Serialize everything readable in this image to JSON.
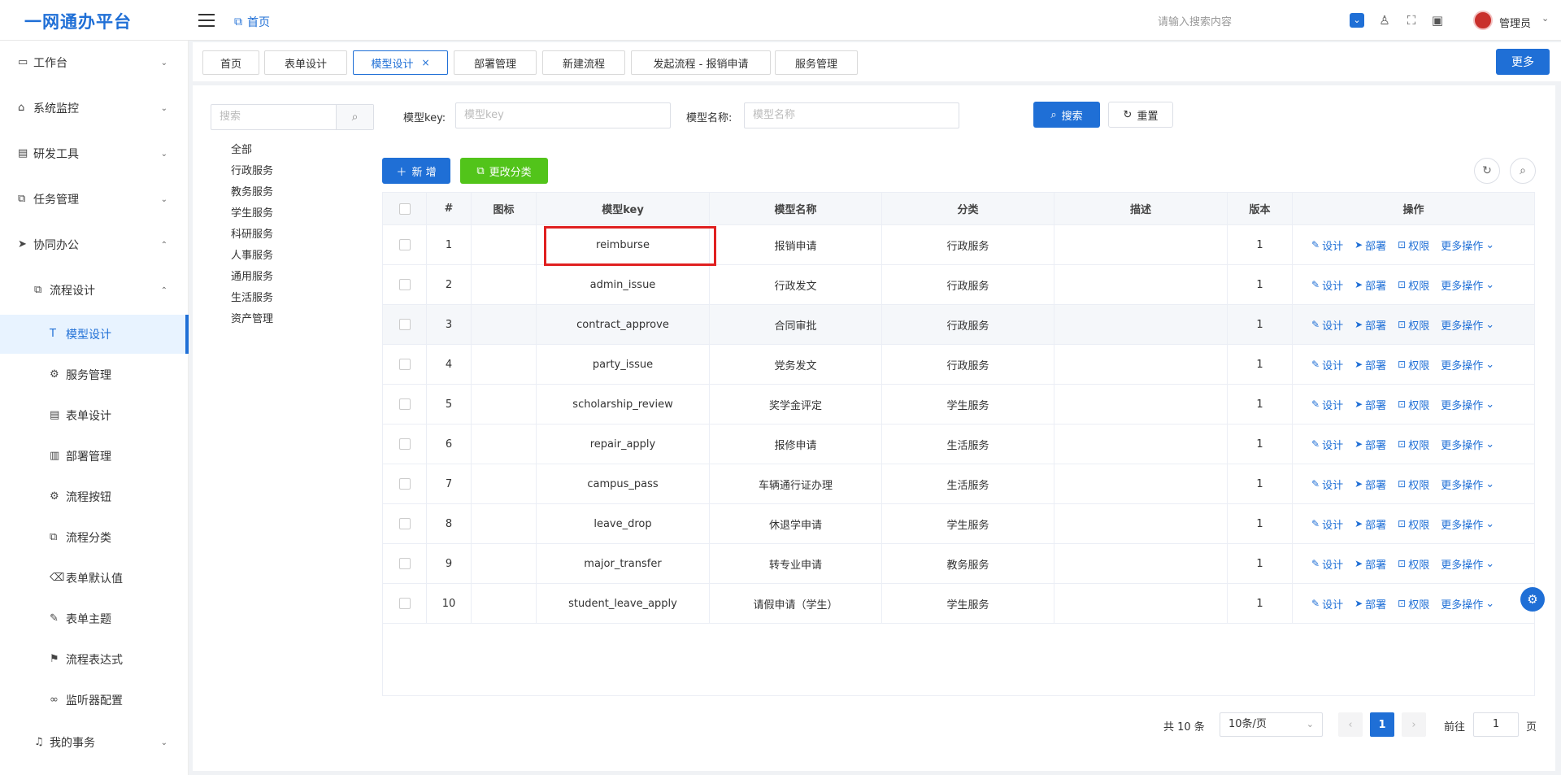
{
  "header": {
    "logo": "一网通办平台",
    "breadcrumb": "首页",
    "search_placeholder": "请输入搜索内容",
    "user": "管理员"
  },
  "sidebar": {
    "items": [
      {
        "label": "工作台",
        "icon": "monitor-icon",
        "caret": "⌄"
      },
      {
        "label": "系统监控",
        "icon": "bank-icon",
        "caret": "⌄"
      },
      {
        "label": "研发工具",
        "icon": "tool-icon",
        "caret": "⌄"
      },
      {
        "label": "任务管理",
        "icon": "task-icon",
        "caret": "⌄"
      },
      {
        "label": "协同办公",
        "icon": "send-icon",
        "caret": "⌃"
      },
      {
        "label": "流程设计",
        "icon": "flow-icon",
        "caret": "⌃"
      },
      {
        "label": "模型设计",
        "icon": "model-icon"
      },
      {
        "label": "服务管理",
        "icon": "gear-icon"
      },
      {
        "label": "表单设计",
        "icon": "form-icon"
      },
      {
        "label": "部署管理",
        "icon": "chart-icon"
      },
      {
        "label": "流程按钮",
        "icon": "gear-icon"
      },
      {
        "label": "流程分类",
        "icon": "flow-icon"
      },
      {
        "label": "表单默认值",
        "icon": "tag-icon"
      },
      {
        "label": "表单主题",
        "icon": "wrench-icon"
      },
      {
        "label": "流程表达式",
        "icon": "flag-icon"
      },
      {
        "label": "监听器配置",
        "icon": "link-icon"
      },
      {
        "label": "我的事务",
        "icon": "bell-icon",
        "caret": "⌄"
      }
    ]
  },
  "tabs": [
    {
      "label": "首页"
    },
    {
      "label": "表单设计"
    },
    {
      "label": "模型设计",
      "close": "×"
    },
    {
      "label": "部署管理"
    },
    {
      "label": "新建流程"
    },
    {
      "label": "发起流程 - 报销申请"
    },
    {
      "label": "服务管理"
    }
  ],
  "more_label": "更多",
  "tree": {
    "search_placeholder": "搜索",
    "nodes": [
      "全部",
      "行政服务",
      "教务服务",
      "学生服务",
      "科研服务",
      "人事服务",
      "通用服务",
      "生活服务",
      "资产管理"
    ]
  },
  "filters": {
    "key_label": "模型key:",
    "key_placeholder": "模型key",
    "name_label": "模型名称:",
    "name_placeholder": "模型名称",
    "search_label": "搜索",
    "reset_label": "重置"
  },
  "toolbar": {
    "add_label": "新 增",
    "category_label": "更改分类"
  },
  "table": {
    "columns": [
      "#",
      "图标",
      "模型key",
      "模型名称",
      "分类",
      "描述",
      "版本",
      "操作"
    ],
    "rows": [
      {
        "no": "1",
        "key": "reimburse",
        "name": "报销申请",
        "category": "行政服务",
        "desc": "",
        "version": "1"
      },
      {
        "no": "2",
        "key": "admin_issue",
        "name": "行政发文",
        "category": "行政服务",
        "desc": "",
        "version": "1"
      },
      {
        "no": "3",
        "key": "contract_approve",
        "name": "合同审批",
        "category": "行政服务",
        "desc": "",
        "version": "1"
      },
      {
        "no": "4",
        "key": "party_issue",
        "name": "党务发文",
        "category": "行政服务",
        "desc": "",
        "version": "1"
      },
      {
        "no": "5",
        "key": "scholarship_review",
        "name": "奖学金评定",
        "category": "学生服务",
        "desc": "",
        "version": "1"
      },
      {
        "no": "6",
        "key": "repair_apply",
        "name": "报修申请",
        "category": "生活服务",
        "desc": "",
        "version": "1"
      },
      {
        "no": "7",
        "key": "campus_pass",
        "name": "车辆通行证办理",
        "category": "生活服务",
        "desc": "",
        "version": "1"
      },
      {
        "no": "8",
        "key": "leave_drop",
        "name": "休退学申请",
        "category": "学生服务",
        "desc": "",
        "version": "1"
      },
      {
        "no": "9",
        "key": "major_transfer",
        "name": "转专业申请",
        "category": "教务服务",
        "desc": "",
        "version": "1"
      },
      {
        "no": "10",
        "key": "student_leave_apply",
        "name": "请假申请（学生）",
        "category": "学生服务",
        "desc": "",
        "version": "1"
      }
    ],
    "ops": {
      "design": "设计",
      "deploy": "部署",
      "perm": "权限",
      "more": "更多操作"
    }
  },
  "pagination": {
    "total": "共 10 条",
    "page_size": "10条/页",
    "current": "1",
    "goto_label": "前往",
    "goto_value": "1",
    "page_unit": "页"
  },
  "colors": {
    "primary": "#1f6fd6",
    "success": "#52c41a",
    "highlight": "#e02020"
  }
}
